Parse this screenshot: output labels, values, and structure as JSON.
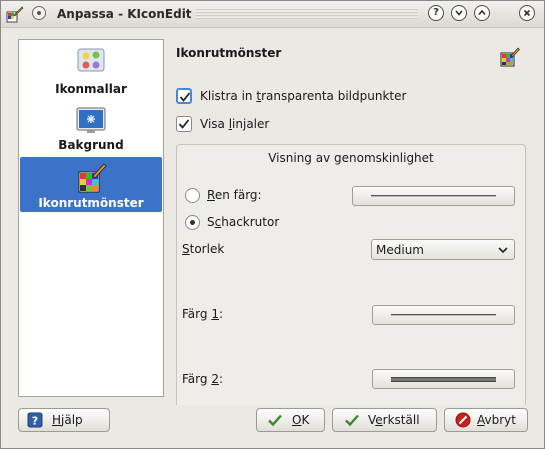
{
  "window": {
    "title": "Anpassa - KIconEdit"
  },
  "titlebar_buttons": {
    "help": "?",
    "minimize": "⌄",
    "maximize": "⌃",
    "close": "✕"
  },
  "sidebar": {
    "items": [
      {
        "label": "Ikonmallar",
        "icon": "templates-icon",
        "selected": false
      },
      {
        "label": "Bakgrund",
        "icon": "background-icon",
        "selected": false
      },
      {
        "label": "Ikonrutmönster",
        "icon": "icon-grid-icon",
        "selected": true
      }
    ]
  },
  "page": {
    "title": "Ikonrutmönster",
    "paste_transparent": {
      "label_pre": "Klistra in ",
      "label_u": "t",
      "label_post": "ransparenta bildpunkter",
      "checked": true
    },
    "show_rulers": {
      "label_pre": "Visa ",
      "label_u": "l",
      "label_post": "injaler",
      "checked": true
    },
    "transparency": {
      "title": "Visning av genomskinlighet",
      "solid_color": {
        "label_u": "R",
        "label_post": "en färg:",
        "selected": false
      },
      "checkerboard": {
        "label_pre": "S",
        "label_u": "c",
        "label_post": "hackrutor",
        "selected": true
      },
      "size": {
        "label_u": "S",
        "label_post": "torlek",
        "value": "Medium"
      },
      "color1": {
        "label_pre": "Färg ",
        "label_u": "1",
        "label_post": ":"
      },
      "color2": {
        "label_pre": "Färg ",
        "label_u": "2",
        "label_post": ":"
      }
    }
  },
  "buttons": {
    "help": {
      "label_u": "H",
      "label_post": "jälp"
    },
    "ok": {
      "label_u": "O",
      "label_post": "K"
    },
    "apply": {
      "label_pre": "V",
      "label_u": "e",
      "label_post": "rkställ"
    },
    "cancel": {
      "label_u": "A",
      "label_post": "vbryt"
    }
  },
  "colors": {
    "selection": "#3a73c8",
    "focus": "#4a86d8",
    "cancel_red": "#c8241e",
    "check_green": "#3a8a2a"
  }
}
